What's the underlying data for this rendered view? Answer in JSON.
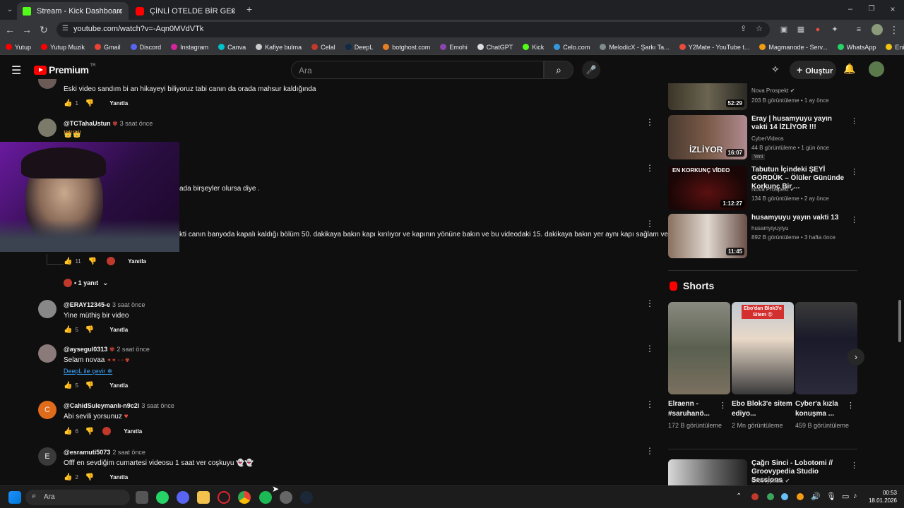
{
  "browser": {
    "tabs": [
      {
        "title": "Stream - Kick Dashboard",
        "active": true
      },
      {
        "title": "ÇİNLİ OTELDE BİR GECE! Unutul",
        "active": false
      }
    ],
    "url": "youtube.com/watch?v=-Aqn0MVdVTk",
    "bookmarks": [
      "Yutup",
      "Yutup Muzik",
      "Gmail",
      "Discord",
      "Instagram",
      "Canva",
      "Kafiye bulma",
      "Celal",
      "DeepL",
      "botghost.com",
      "Emohi",
      "ChatGPT",
      "Kick",
      "Celo.com",
      "MelodicX - Şarkı Ta...",
      "Y2Mate - YouTube t...",
      "Magmanode - Serv...",
      "WhatsApp",
      "Enik Gang"
    ]
  },
  "youtube": {
    "logo": "Premium",
    "logo_badge": "TR",
    "search_placeholder": "Ara",
    "create_label": "Oluştur"
  },
  "comments": [
    {
      "user": "",
      "time": "",
      "text": "Eski video sandım bi an hikayeyi biliyoruz tabi canın da orada mahsur kaldığında",
      "likes": "1",
      "reply_label": "Yanıtla"
    },
    {
      "user": "@TCTahaUstun",
      "time": "3 saat önce",
      "text": "👑👑",
      "likes": "",
      "reply_label": ""
    },
    {
      "user": "",
      "time": "",
      "text": "ada birşeyler olursa diye .",
      "likes": "",
      "reply_label": ""
    },
    {
      "user": "",
      "time": "",
      "text": "kti canın banyoda kapalı kaldığı bölüm  50. dakikaya bakın kapı kırılıyor ve kapının  yönüne bakın  ve bu videodaki 15. dakikaya bakın yer aynı kapı sağlam ve yönü",
      "likes": "11",
      "reply_label": "Yanıtla"
    },
    {
      "user": "@ERAY12345-e",
      "time": "3 saat önce",
      "text": "Yine müthiş bir video",
      "likes": "5",
      "reply_label": "Yanıtla"
    },
    {
      "user": "@aysegul0313",
      "time": "2 saat önce",
      "text": "Selam novaa",
      "translate": "DeepL ile çevir",
      "likes": "5",
      "reply_label": "Yanıtla"
    },
    {
      "user": "@CahidSuleymanlı-n9c2i",
      "time": "3 saat önce",
      "text": "Abi sevili yorsunuz",
      "likes": "6",
      "reply_label": "Yanıtla"
    },
    {
      "user": "@esramuti5073",
      "time": "2 saat önce",
      "text": "Offf en sevdiğim cumartesi videosu 1 saat ver coşkuyu 👻👻",
      "likes": "2",
      "reply_label": "Yanıtla"
    }
  ],
  "replies_toggle": "• 1 yanıt",
  "sidebar_videos": [
    {
      "title": "",
      "channel": "Nova Prospekt",
      "meta": "203 B görüntüleme • 1 ay önce",
      "duration": "52:29",
      "badge": ""
    },
    {
      "title": "Eray | husamyuyu yayın vakti 14 İZLİYOR !!!",
      "channel": "CyberVideos",
      "meta": "44 B görüntüleme • 1 gün önce",
      "duration": "16:07",
      "badge": "Yeni"
    },
    {
      "title": "Tabutun İçindeki ŞEYİ GÖRDÜK – Ölüler Gününde Korkunç Bir ...",
      "channel": "Nova Prospekt",
      "meta": "134 B görüntüleme • 2 ay önce",
      "duration": "1:12:27",
      "badge": ""
    },
    {
      "title": "husamyuyu yayın vakti 13",
      "channel": "husamyiyuyiyu",
      "meta": "892 B görüntüleme • 3 hafta önce",
      "duration": "11:45",
      "badge": ""
    }
  ],
  "shorts": {
    "heading": "Shorts",
    "items": [
      {
        "title": "Elraenn - #saruhanö...",
        "views": "172 B görüntüleme",
        "overlay": ""
      },
      {
        "title": "Ebo Blok3'e sitem ediyo...",
        "views": "2 Mn görüntüleme",
        "overlay": "Ebo'dan Blok3'e Sitem 😡"
      },
      {
        "title": "Cyber'a kızla konuşma ...",
        "views": "459 B görüntüleme",
        "overlay": ""
      }
    ]
  },
  "bottom_video": {
    "title": "Çağrı Sinci - Lobotomi // Groovypedia Studio Sessions",
    "channel": "Groovypedia"
  },
  "taskbar": {
    "search": "Ara",
    "time": "00:53",
    "date": "18.01.2026"
  },
  "colors": {
    "yt_red": "#ff0000",
    "kick_green": "#53fc18",
    "accent_link": "#3ea6ff"
  }
}
